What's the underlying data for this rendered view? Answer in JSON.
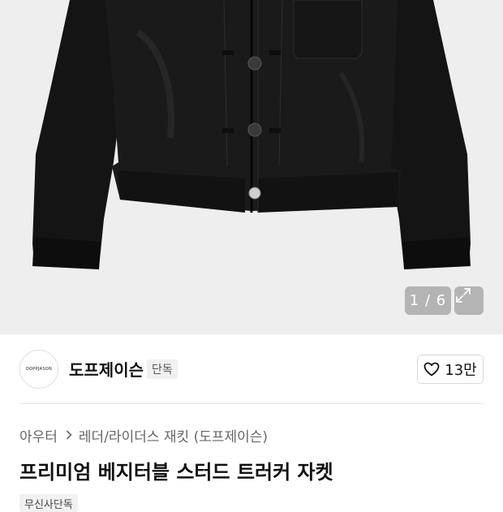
{
  "gallery": {
    "counter": "1 / 6",
    "image_alt": "black leather trucker jacket product photo"
  },
  "brand": {
    "logo_text": "DOPPJASON",
    "name": "도프제이슨",
    "exclusive_badge": "단독",
    "like_count": "13만"
  },
  "breadcrumb": {
    "category": "아우터",
    "subcategory": "레더/라이더스 재킷 (도프제이슨)"
  },
  "product": {
    "title": "프리미엄 베지터블 스터드 트러커 자켓",
    "badge": "무신사단독"
  },
  "icons": {
    "expand": "expand-icon",
    "like": "heart-icon",
    "chevron": "chevron-right-icon"
  },
  "colors": {
    "hero_background": "#eeeeee",
    "jacket": "#111111",
    "text_primary": "#111111",
    "text_secondary": "#666666"
  }
}
